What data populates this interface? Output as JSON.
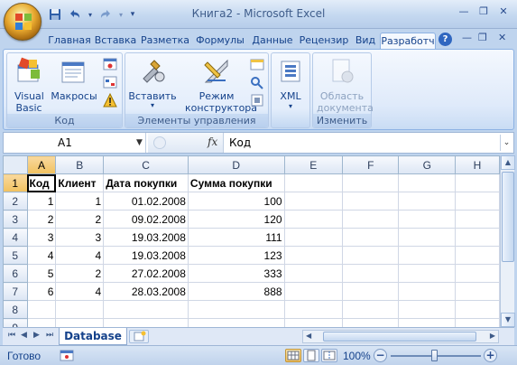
{
  "window": {
    "title": "Книга2 - Microsoft Excel"
  },
  "tabs": [
    {
      "label": "Главная"
    },
    {
      "label": "Вставка"
    },
    {
      "label": "Разметка"
    },
    {
      "label": "Формулы"
    },
    {
      "label": "Данные"
    },
    {
      "label": "Рецензир"
    },
    {
      "label": "Вид"
    },
    {
      "label": "Разработч"
    }
  ],
  "ribbon": {
    "groups": {
      "code": {
        "label": "Код",
        "visual_basic": "Visual Basic",
        "macros": "Макросы"
      },
      "controls": {
        "label": "Элементы управления",
        "insert": "Вставить",
        "design_mode": "Режим конструктора"
      },
      "xml": {
        "label": "XML"
      },
      "modify": {
        "label": "Изменить",
        "doc_panel": "Область документа"
      }
    }
  },
  "formula_bar": {
    "name_box": "A1",
    "fx": "fx",
    "formula": "Код"
  },
  "grid": {
    "columns": [
      "A",
      "B",
      "C",
      "D",
      "E",
      "F",
      "G",
      "H"
    ],
    "rows": [
      {
        "num": "1",
        "cells": [
          "Код",
          "Клиент",
          "Дата покупки",
          "Сумма покупки",
          "",
          "",
          "",
          ""
        ]
      },
      {
        "num": "2",
        "cells": [
          "1",
          "1",
          "01.02.2008",
          "100",
          "",
          "",
          "",
          ""
        ]
      },
      {
        "num": "3",
        "cells": [
          "2",
          "2",
          "09.02.2008",
          "120",
          "",
          "",
          "",
          ""
        ]
      },
      {
        "num": "4",
        "cells": [
          "3",
          "3",
          "19.03.2008",
          "111",
          "",
          "",
          "",
          ""
        ]
      },
      {
        "num": "5",
        "cells": [
          "4",
          "4",
          "19.03.2008",
          "123",
          "",
          "",
          "",
          ""
        ]
      },
      {
        "num": "6",
        "cells": [
          "5",
          "2",
          "27.02.2008",
          "333",
          "",
          "",
          "",
          ""
        ]
      },
      {
        "num": "7",
        "cells": [
          "6",
          "4",
          "28.03.2008",
          "888",
          "",
          "",
          "",
          ""
        ]
      },
      {
        "num": "8",
        "cells": [
          "",
          "",
          "",
          "",
          "",
          "",
          "",
          ""
        ]
      },
      {
        "num": "9",
        "cells": [
          "",
          "",
          "",
          "",
          "",
          "",
          "",
          ""
        ]
      }
    ]
  },
  "sheets": {
    "active": "Database"
  },
  "status": {
    "text": "Готово",
    "zoom": "100%",
    "zoom_minus": "−",
    "zoom_plus": "+"
  },
  "colors": {
    "accent": "#15428b",
    "selected_header": "#f1c15f"
  }
}
